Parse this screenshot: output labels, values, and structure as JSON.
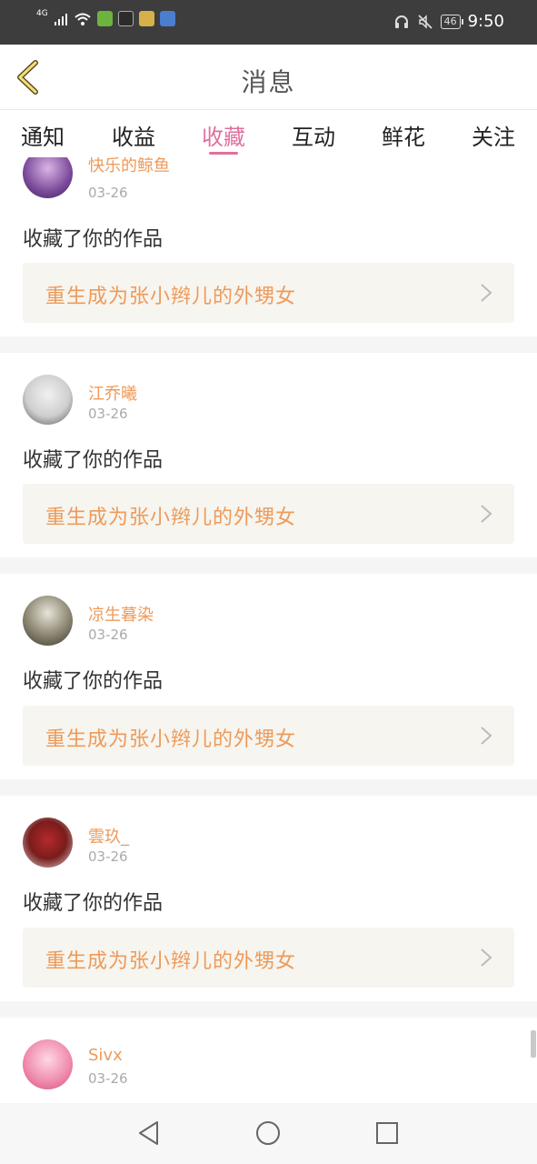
{
  "status_bar": {
    "network": "4G",
    "battery": "46",
    "time": "9:50"
  },
  "header": {
    "title": "消息"
  },
  "tabs": [
    {
      "label": "通知"
    },
    {
      "label": "收益"
    },
    {
      "label": "收藏"
    },
    {
      "label": "互动"
    },
    {
      "label": "鲜花"
    },
    {
      "label": "关注"
    }
  ],
  "active_tab": "收藏",
  "messages": [
    {
      "username": "快乐的鲸鱼",
      "date": "03-26",
      "action": "收藏了你的作品",
      "work_title": "重生成为张小辫儿的外甥女"
    },
    {
      "username": "江乔曦",
      "date": "03-26",
      "action": "收藏了你的作品",
      "work_title": "重生成为张小辫儿的外甥女"
    },
    {
      "username": "凉生暮染",
      "date": "03-26",
      "action": "收藏了你的作品",
      "work_title": "重生成为张小辫儿的外甥女"
    },
    {
      "username": "雲玖_",
      "date": "03-26",
      "action": "收藏了你的作品",
      "work_title": "重生成为张小辫儿的外甥女"
    },
    {
      "username": "Sivx",
      "date": "03-26",
      "action": "",
      "work_title": ""
    }
  ],
  "colors": {
    "accent_pink": "#e06f9e",
    "username_orange": "#ee9a5a",
    "status_bar_bg": "#3d3d3d"
  }
}
